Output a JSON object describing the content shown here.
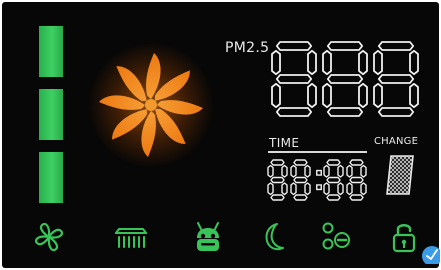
{
  "colors": {
    "panel_background": "#070707",
    "indicator_green": "#39c45a",
    "fan_orange": "#f08a1a",
    "glow_orange": "#ff7a10",
    "segment_white": "#f0f0f0",
    "badge_blue": "#3a9be6"
  },
  "level_indicator": {
    "segments_lit": 3,
    "segments_total": 3
  },
  "pm25": {
    "label": "PM2.5",
    "display": "888"
  },
  "time": {
    "label": "TIME",
    "display": "88:88"
  },
  "filter": {
    "label": "CHANGE",
    "icon": "filter-mesh-icon"
  },
  "mode_icons": [
    {
      "name": "fan-mode-icon"
    },
    {
      "name": "heater-icon"
    },
    {
      "name": "auto-robot-icon"
    },
    {
      "name": "sleep-moon-icon"
    },
    {
      "name": "speed-level-icon"
    },
    {
      "name": "child-lock-icon"
    }
  ],
  "corner_badge": {
    "icon": "check-icon"
  }
}
